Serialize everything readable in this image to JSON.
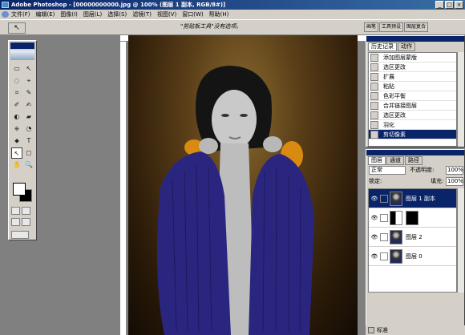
{
  "window": {
    "title": "Adobe Photoshop - [00000000000.jpg @ 100% (图层 1 副本, RGB/8#)]",
    "min": "_",
    "max": "□",
    "close": "×"
  },
  "menu": [
    "文件(F)",
    "编辑(E)",
    "图像(I)",
    "图层(L)",
    "选择(S)",
    "滤镜(T)",
    "视图(V)",
    "窗口(W)",
    "帮助(H)"
  ],
  "options": {
    "hint": "\"剪贴板工具\"没有选项。",
    "tool_glyph": "↖"
  },
  "palette_well": [
    "画笔",
    "工具预设",
    "图层复合"
  ],
  "toolbox": {
    "tools": [
      "▭",
      "↖",
      "◌",
      "⌖",
      "⌗",
      "✎",
      "✐",
      "✍",
      "◐",
      "▰",
      "⎈",
      "◔",
      "⬥",
      "T",
      "↖",
      "◻",
      "✋",
      "🔍"
    ]
  },
  "history": {
    "tabs": [
      "历史记录",
      "动作"
    ],
    "items": [
      "添加图层蒙版",
      "选区更改",
      "扩展",
      "粘贴",
      "色彩平衡",
      "合并链接图层",
      "选区更改",
      "羽化",
      "剪切像素"
    ],
    "selected_index": 8
  },
  "layers": {
    "tabs": [
      "图层",
      "通道",
      "路径"
    ],
    "blend_mode": "正常",
    "opacity_label": "不透明度:",
    "opacity": "100%",
    "lock_label": "锁定:",
    "fill_label": "填充:",
    "fill": "100%",
    "rows": [
      {
        "name": "图层 1 副本",
        "selected": true,
        "thumb": "photo"
      },
      {
        "name": "",
        "selected": false,
        "thumb": "bw"
      },
      {
        "name": "图层 2",
        "selected": false,
        "thumb": "photo"
      },
      {
        "name": "图层 0",
        "selected": false,
        "thumb": "photo"
      }
    ]
  },
  "status": {
    "mode_label": "标准"
  }
}
